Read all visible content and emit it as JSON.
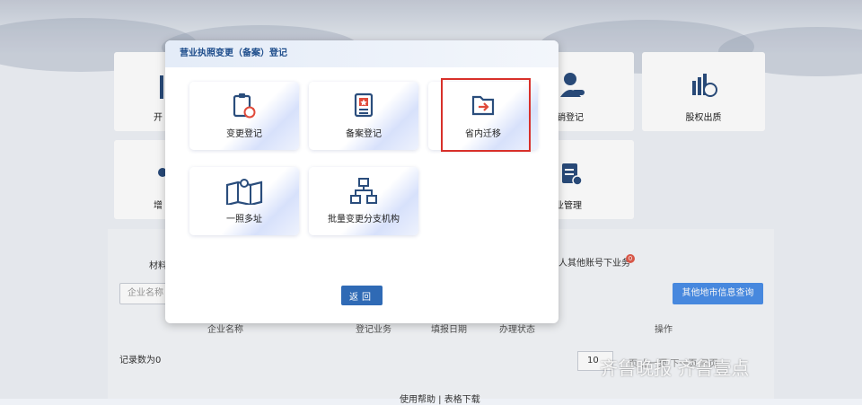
{
  "modal": {
    "title": "营业执照变更（备案）登记",
    "cards": [
      {
        "label": "变更登记",
        "icon": "clipboard-refresh-icon"
      },
      {
        "label": "备案登记",
        "icon": "certificate-icon"
      },
      {
        "label": "省内迁移",
        "icon": "folder-transfer-icon"
      },
      {
        "label": "一照多址",
        "icon": "map-location-icon"
      },
      {
        "label": "批量变更分支机构",
        "icon": "org-chart-icon"
      }
    ],
    "return_label": "返回"
  },
  "background": {
    "tiles": {
      "kai": "开",
      "zeng": "增",
      "cancel": "注销登记",
      "pledge": "股权出质",
      "industry": "业管理"
    },
    "tab_material": "材料",
    "other_business": "人其他账号下业务",
    "badge_count": "0",
    "search_placeholder": "企业名称",
    "query_button": "其他地市信息查询",
    "table_headers": [
      "企业名称",
      "登记业务",
      "填报日期",
      "办理状态",
      "操作"
    ],
    "record_count": "记录数为0",
    "page_size": "10",
    "pager_fragment": "页 上一页 下一页 尾页",
    "footer_fragment": "使用帮助 | 表格下载",
    "watermark": "齐鲁晚报 齐鲁壹点"
  },
  "colors": {
    "accent": "#2f6ab5",
    "query_button": "#4a8ee8",
    "highlight": "#d8302a"
  }
}
